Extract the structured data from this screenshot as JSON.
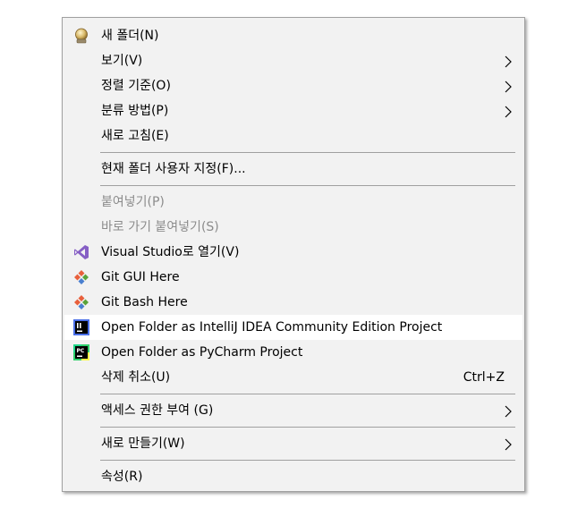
{
  "menu": {
    "items": [
      {
        "label": "새 폴더(N)",
        "icon": "new-folder-icon"
      },
      {
        "label": "보기(V)",
        "submenu": true
      },
      {
        "label": "정렬 기준(O)",
        "submenu": true
      },
      {
        "label": "분류 방법(P)",
        "submenu": true
      },
      {
        "label": "새로 고침(E)"
      },
      {
        "label": "현재 폴더 사용자 지정(F)..."
      },
      {
        "label": "붙여넣기(P)",
        "disabled": true
      },
      {
        "label": "바로 가기 붙여넣기(S)",
        "disabled": true
      },
      {
        "label": "Visual Studio로 열기(V)",
        "icon": "visual-studio-icon"
      },
      {
        "label": "Git GUI Here",
        "icon": "git-icon"
      },
      {
        "label": "Git Bash Here",
        "icon": "git-icon"
      },
      {
        "label": "Open Folder as IntelliJ IDEA Community Edition Project",
        "icon": "intellij-idea-icon",
        "highlighted": true
      },
      {
        "label": "Open Folder as PyCharm Project",
        "icon": "pycharm-icon"
      },
      {
        "label": "삭제 취소(U)",
        "shortcut": "Ctrl+Z"
      },
      {
        "label": "액세스 권한 부여 (G)",
        "submenu": true
      },
      {
        "label": "새로 만들기(W)",
        "submenu": true
      },
      {
        "label": "속성(R)"
      }
    ],
    "colors": {
      "background": "#f2f2f2",
      "highlight": "#ffffff",
      "disabled_text": "#8c8c8c",
      "separator": "#a0a0a0"
    }
  }
}
